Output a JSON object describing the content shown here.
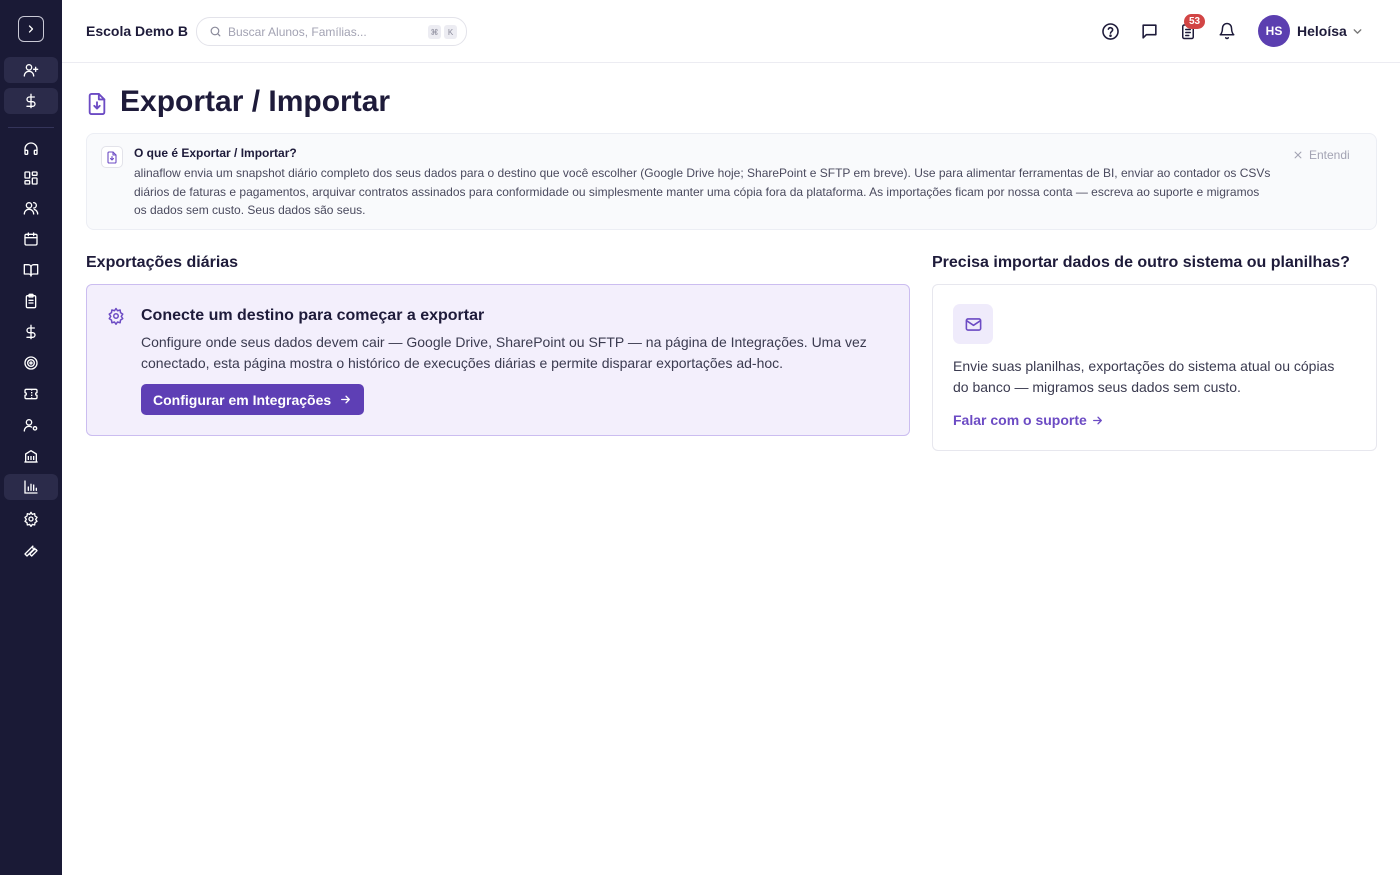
{
  "sidebar": {
    "items": [
      {
        "icon": "user-plus-icon"
      },
      {
        "icon": "dollar-icon"
      },
      {
        "icon": "headset-icon"
      },
      {
        "icon": "dashboard-grid-icon"
      },
      {
        "icon": "users-icon"
      },
      {
        "icon": "calendar-icon"
      },
      {
        "icon": "book-open-icon"
      },
      {
        "icon": "clipboard-icon"
      },
      {
        "icon": "dollar-icon"
      },
      {
        "icon": "target-icon"
      },
      {
        "icon": "ticket-icon"
      },
      {
        "icon": "user-cog-icon"
      },
      {
        "icon": "building-icon"
      },
      {
        "icon": "bar-chart-icon"
      },
      {
        "icon": "gear-icon"
      },
      {
        "icon": "wrench-icon"
      }
    ]
  },
  "header": {
    "school": "Escola Demo B",
    "search_placeholder": "Buscar Alunos, Famílias...",
    "kbd_cmd": "⌘",
    "kbd_k": "K",
    "badge_count": "53",
    "avatar_initials": "HS",
    "user_name": "Heloísa"
  },
  "page": {
    "title": "Exportar / Importar"
  },
  "info": {
    "title": "O que é Exportar / Importar?",
    "body": "alinaflow envia um snapshot diário completo dos seus dados para o destino que você escolher (Google Drive hoje; SharePoint e SFTP em breve). Use para alimentar ferramentas de BI, enviar ao contador os CSVs diários de faturas e pagamentos, arquivar contratos assinados para conformidade ou simplesmente manter uma cópia fora da plataforma. As importações ficam por nossa conta — escreva ao suporte e migramos os dados sem custo. Seus dados são seus.",
    "dismiss": "Entendi"
  },
  "exports": {
    "heading": "Exportações diárias",
    "card_title": "Conecte um destino para começar a exportar",
    "card_body": "Configure onde seus dados devem cair — Google Drive, SharePoint ou SFTP — na página de Integrações. Uma vez conectado, esta página mostra o histórico de execuções diárias e permite disparar exportações ad-hoc.",
    "button": "Configurar em Integrações"
  },
  "imports": {
    "heading": "Precisa importar dados de outro sistema ou planilhas?",
    "body": "Envie suas planilhas, exportações do sistema atual ou cópias do banco — migramos seus dados sem custo.",
    "link": "Falar com o suporte"
  },
  "colors": {
    "sidebar_bg": "#1a1a36",
    "accent": "#5e3fb5",
    "badge": "#d24545"
  }
}
